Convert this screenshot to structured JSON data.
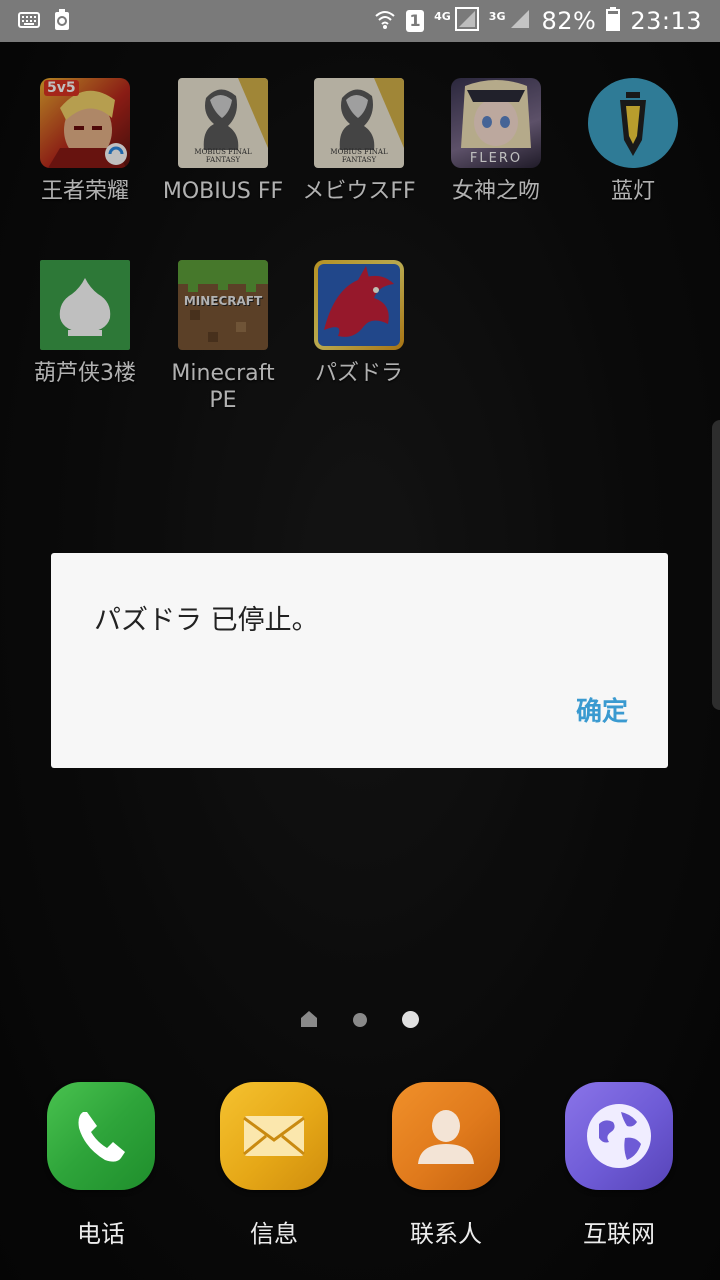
{
  "status_bar": {
    "net1": "4G",
    "net2": "3G",
    "battery": "82%",
    "time": "23:13",
    "sim_number": "1"
  },
  "apps": [
    {
      "label": "王者荣耀",
      "icon": "honor-of-kings-icon"
    },
    {
      "label": "MOBIUS FF",
      "icon": "mobius-ff-icon"
    },
    {
      "label": "メビウスFF",
      "icon": "mobius-ff-jp-icon"
    },
    {
      "label": "女神之吻",
      "icon": "goddess-kiss-icon"
    },
    {
      "label": "蓝灯",
      "icon": "lantern-icon"
    },
    {
      "label": "葫芦侠3楼",
      "icon": "huluxia-icon"
    },
    {
      "label": "Minecraft PE",
      "icon": "minecraft-icon"
    },
    {
      "label": "パズドラ",
      "icon": "puzzle-dragons-icon"
    }
  ],
  "dialog": {
    "message": "パズドラ 已停止。",
    "ok_label": "确定",
    "accent": "#3a9ad0"
  },
  "dock": [
    {
      "label": "电话",
      "icon": "phone-icon",
      "color": "#2ea43a"
    },
    {
      "label": "信息",
      "icon": "message-icon",
      "color": "#e6a817"
    },
    {
      "label": "联系人",
      "icon": "contacts-icon",
      "color": "#e07a1c"
    },
    {
      "label": "互联网",
      "icon": "internet-icon",
      "color": "#6e5bd6"
    }
  ],
  "icon_text": {
    "hok_badge": "5v5",
    "mobius_caption": "MOBIUS FINAL FANTASY",
    "flero": "FLERO",
    "minecraft": "MINECRAFT"
  }
}
